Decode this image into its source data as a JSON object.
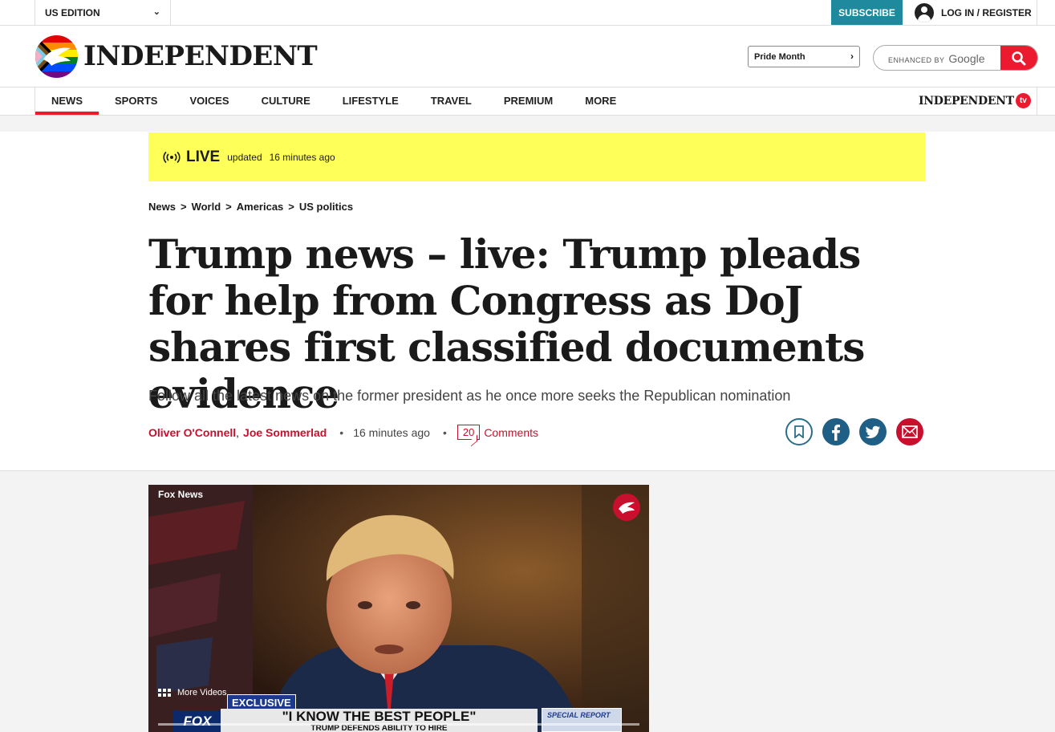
{
  "topbar": {
    "edition": "US EDITION",
    "subscribe": "SUBSCRIBE",
    "login": "LOG IN / REGISTER"
  },
  "masthead": {
    "logo_text": "INDEPENDENT",
    "pride_label": "Pride Month",
    "search_placeholder_prefix": "ENHANCED BY",
    "search_placeholder_brand": "Google"
  },
  "nav": {
    "items": [
      {
        "label": "NEWS",
        "active": true
      },
      {
        "label": "SPORTS"
      },
      {
        "label": "VOICES"
      },
      {
        "label": "CULTURE"
      },
      {
        "label": "LIFESTYLE"
      },
      {
        "label": "TRAVEL"
      },
      {
        "label": "PREMIUM"
      },
      {
        "label": "MORE"
      }
    ],
    "tv_logo_text": "INDEPENDENT",
    "tv_badge": "tv"
  },
  "live": {
    "label": "LIVE",
    "updated": "updated",
    "time_ago": "16 minutes ago"
  },
  "breadcrumb": [
    "News",
    "World",
    "Americas",
    "US politics"
  ],
  "article": {
    "headline": "Trump news – live: Trump pleads for help from Congress as DoJ shares first classified documents evidence",
    "standfirst": "Follow all the latest news on the former president as he once more seeks the Republican nomination",
    "authors": [
      "Oliver O'Connell",
      "Joe Sommerlad"
    ],
    "time_ago": "16 minutes ago",
    "comment_count": "20",
    "comments_label": "Comments"
  },
  "video": {
    "source": "Fox News",
    "more_videos": "More Videos",
    "exclusive": "EXCLUSIVE",
    "chyron_line1": "\"I KNOW THE BEST PEOPLE\"",
    "chyron_line2": "TRUMP DEFENDS ABILITY TO HIRE",
    "network_bug": "FOX",
    "special_report": "SPECIAL REPORT"
  },
  "colors": {
    "brand_red": "#ec1a2e",
    "subscribe_teal": "#1f8a9e",
    "live_yellow": "#ffff59",
    "author_red": "#c8102e",
    "share_blue": "#1f5f86"
  }
}
